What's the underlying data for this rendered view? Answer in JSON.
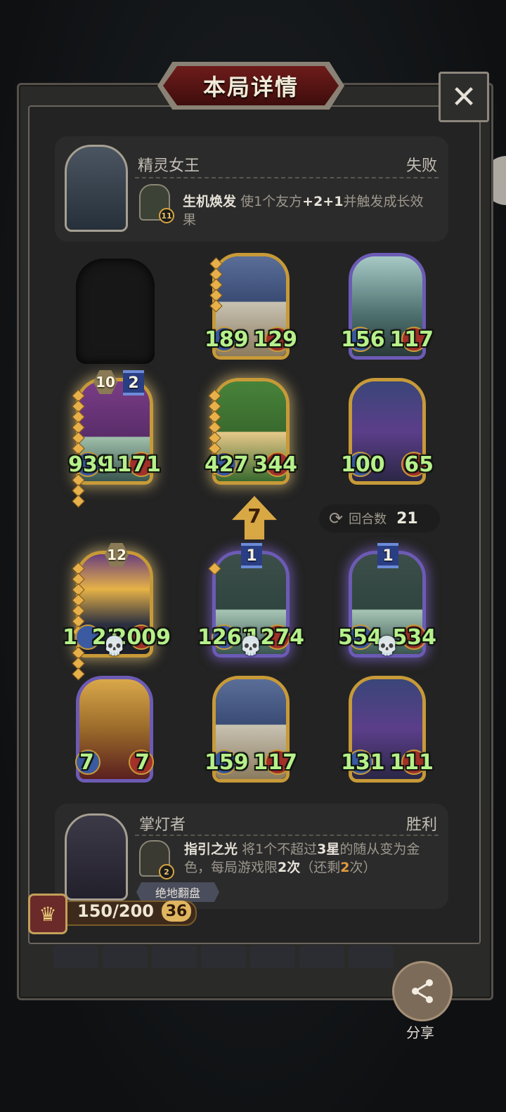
{
  "title": "本局详情",
  "close_glyph": "✕",
  "opponent": {
    "name": "精灵女王",
    "result": "失败",
    "skill_level": "11",
    "skill_name": "生机焕发",
    "skill_desc_1": "使1个友方",
    "skill_desc_bold": "+2+1",
    "skill_desc_2": "并触发成长效果"
  },
  "board_top": {
    "row1": [
      {
        "atk": "189",
        "hp": "129"
      },
      {
        "atk": "156",
        "hp": "117"
      }
    ],
    "row2": [
      {
        "tier": "10",
        "level": "2",
        "atk": "939",
        "hp": "1171"
      },
      {
        "atk": "427",
        "hp": "344"
      },
      {
        "atk": "100",
        "hp": "65"
      }
    ]
  },
  "attack_arrow": "7",
  "rounds": {
    "label": "回合数",
    "value": "21"
  },
  "board_bottom": {
    "row1": [
      {
        "tier": "12",
        "atk": "1",
        "atk_hidden": "21",
        "hp": "2009"
      },
      {
        "level": "1",
        "atk": "1261",
        "hp": "1274"
      },
      {
        "level": "1",
        "atk": "554",
        "hp": "534"
      }
    ],
    "row2": [
      {
        "atk": "7",
        "hp": "7"
      },
      {
        "atk": "159",
        "hp": "117"
      },
      {
        "atk": "131",
        "hp": "111"
      }
    ]
  },
  "player": {
    "name": "掌灯者",
    "result": "胜利",
    "skill_level": "2",
    "skill_name": "指引之光",
    "skill_desc_1": "将1个不超过",
    "skill_desc_b1": "3星",
    "skill_desc_2": "的随从变为金色，每局游戏限",
    "skill_desc_b2": "2次",
    "skill_desc_3": "（还剩",
    "skill_desc_b3": "2",
    "skill_desc_4": "次）",
    "tag": "绝地翻盘",
    "gold": "150/200",
    "level": "36"
  },
  "share_label": "分享",
  "skull_glyph": "💀"
}
